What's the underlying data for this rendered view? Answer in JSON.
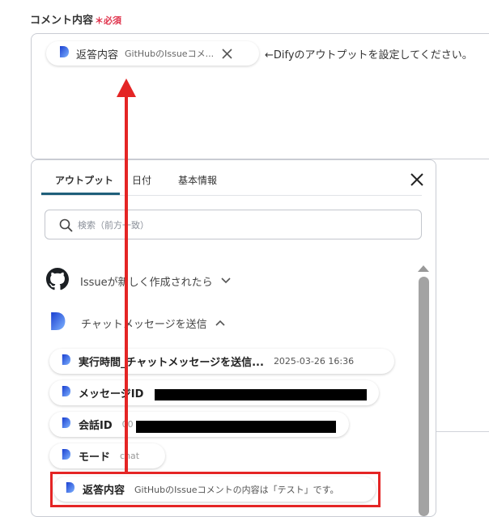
{
  "field": {
    "label": "コメント内容",
    "required_mark": "＊",
    "required_text": "必須",
    "chip": {
      "title": "返答内容",
      "subtitle": "GitHubのIssueコメ...",
      "close_icon": "close-icon"
    },
    "trailing_text": "←Difyのアウトプットを設定してください。"
  },
  "panel": {
    "tabs": [
      {
        "label": "アウトプット",
        "active": true
      },
      {
        "label": "日付",
        "active": false
      },
      {
        "label": "基本情報",
        "active": false
      }
    ],
    "search_placeholder": "検索（前方一致）",
    "sections": [
      {
        "label": "Issueが新しく作成されたら",
        "icon": "github-icon",
        "expanded": false
      },
      {
        "label": "チャットメッセージを送信",
        "icon": "dify-icon",
        "expanded": true
      }
    ],
    "items": [
      {
        "title": "実行時間_チャットメッセージを送信...",
        "value": "2025-03-26 16:36"
      },
      {
        "title": "メッセージID",
        "value": ""
      },
      {
        "title": "会話ID",
        "value": "00"
      },
      {
        "title": "モード",
        "value": "chat"
      },
      {
        "title": "返答内容",
        "value": "GitHubのIssueコメントの内容は「テスト」です。"
      }
    ]
  },
  "colors": {
    "required": "#e0334c",
    "accent": "#1f5f7a",
    "highlight": "#e42525"
  }
}
